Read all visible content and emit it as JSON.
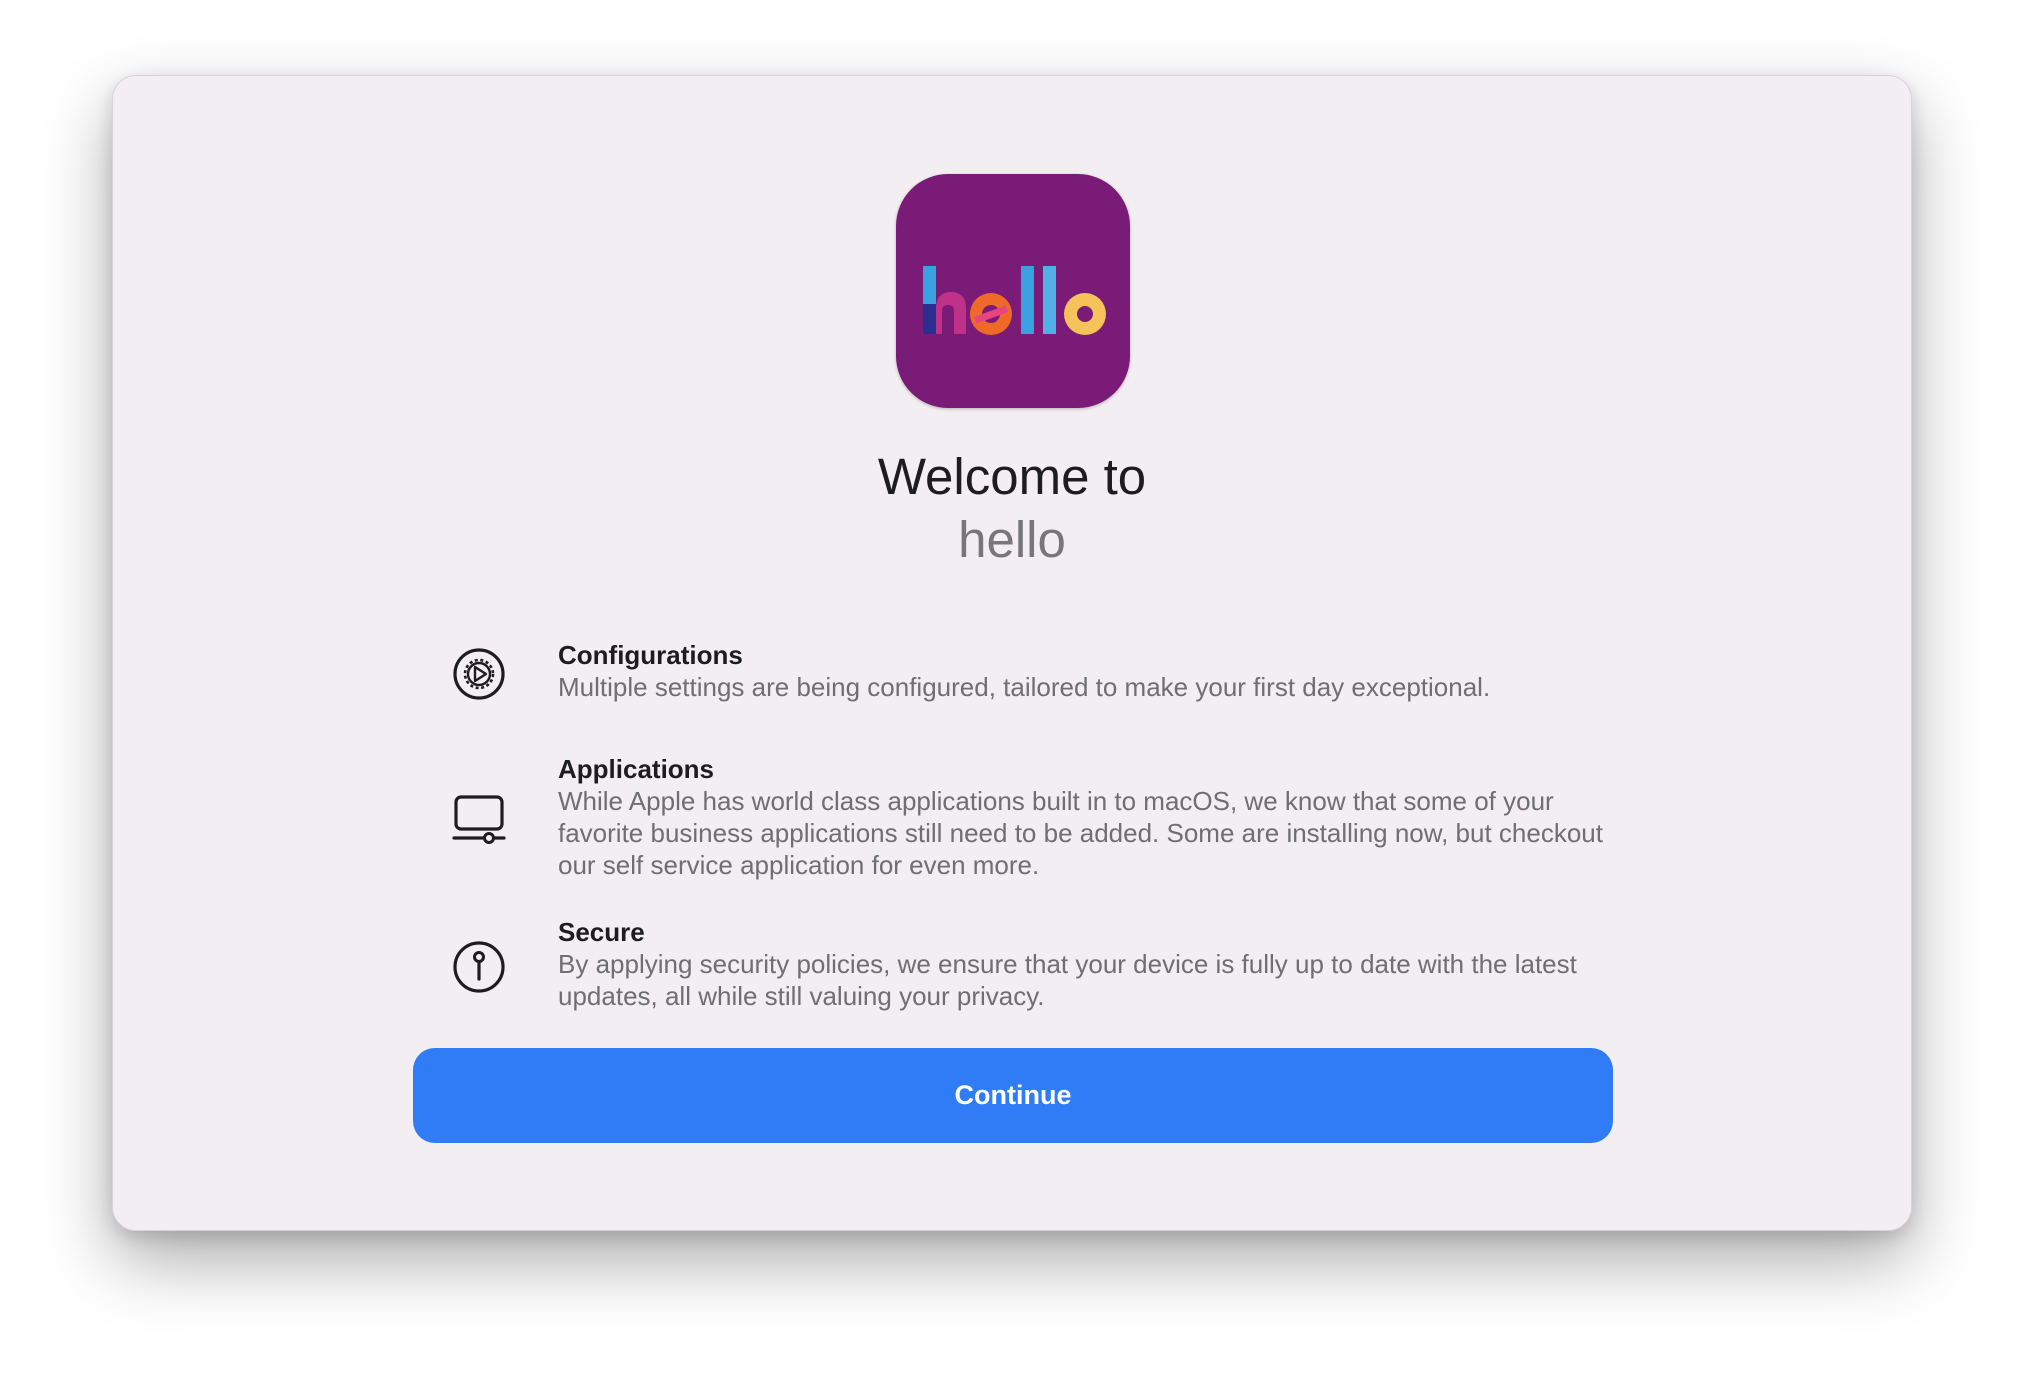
{
  "app": {
    "icon_name": "hello-app-icon",
    "icon_word": "hello",
    "icon_background": "#7b1b78"
  },
  "welcome": {
    "title": "Welcome to",
    "subtitle": "hello"
  },
  "features": [
    {
      "icon": "settings-gear-icon",
      "title": "Configurations",
      "description": "Multiple settings are being configured, tailored to make your first day exceptional."
    },
    {
      "icon": "laptop-icon",
      "title": "Applications",
      "description": "While Apple has world class applications built in to macOS, we know that some of your favorite business applications still need to be added. Some are installing now, but checkout our self service application for even more."
    },
    {
      "icon": "key-lock-icon",
      "title": "Secure",
      "description": "By applying security policies, we ensure that your device is fully up to date with the latest updates, all while still valuing your privacy."
    }
  ],
  "actions": {
    "continue_label": "Continue",
    "accent": "#2f7cf6"
  }
}
